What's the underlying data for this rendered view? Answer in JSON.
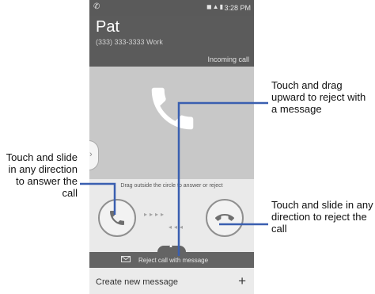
{
  "status_bar": {
    "time": "3:28 PM"
  },
  "caller": {
    "name": "Pat",
    "number_line": "(333) 333-3333  Work",
    "incoming_label": "Incoming call"
  },
  "drag_hint": "Drag outside the circle to answer or reject",
  "reject_bar": {
    "label": "Reject call with message"
  },
  "compose": {
    "label": "Create new message",
    "plus": "+"
  },
  "callouts": {
    "answer": "Touch and slide in any direction to answer the call",
    "reject_with_message": "Touch and drag upward to reject with a message",
    "reject": "Touch and slide in any direction to reject the call"
  },
  "icons": {
    "answer": "phone-answer-icon",
    "reject": "phone-reject-icon",
    "big_handset": "phone-handset-icon",
    "envelope": "envelope-icon"
  },
  "colors": {
    "leader_line": "#3a5fb0",
    "status_bar_bg": "#5a5a5a",
    "call_area_bg": "#c8c8c8",
    "reject_bar_bg": "#646464"
  }
}
